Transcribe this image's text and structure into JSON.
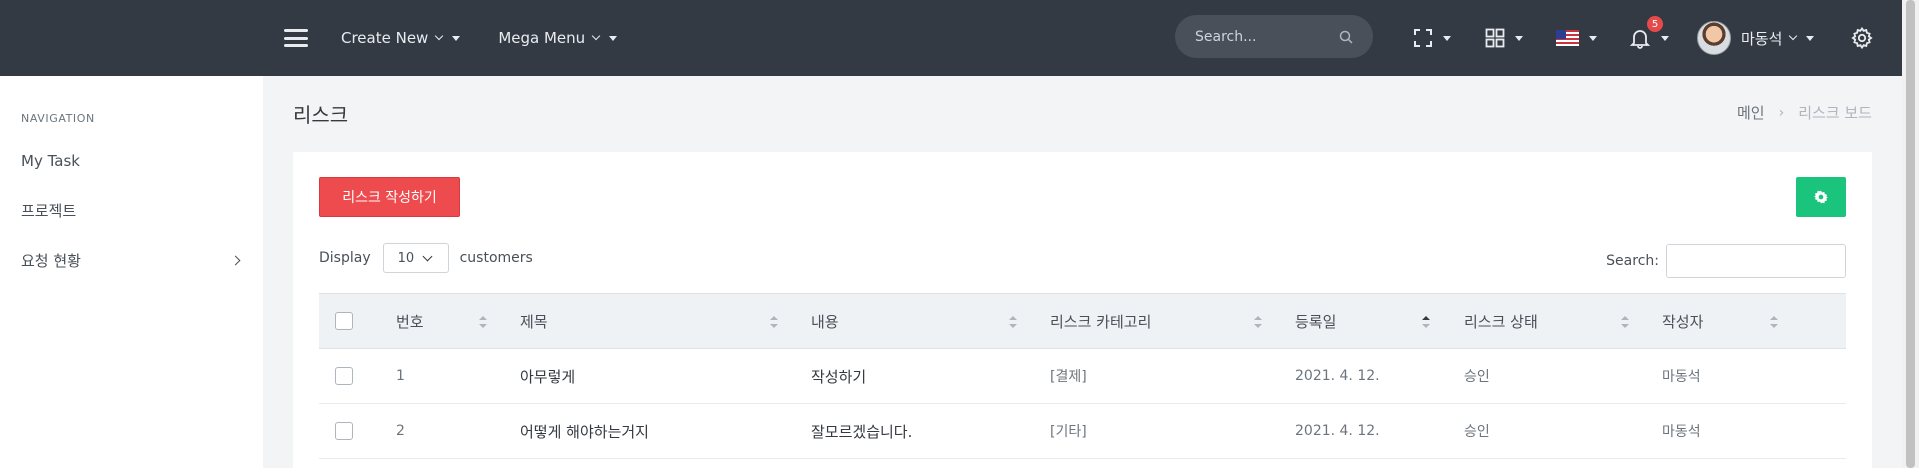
{
  "topbar": {
    "menu_icon": "hamburger-menu-icon",
    "create_new": "Create New",
    "mega_menu": "Mega Menu",
    "search_placeholder": "Search...",
    "notification_count": "5",
    "user_name": "마동석",
    "icons": [
      "fullscreen-icon",
      "apps-grid-icon",
      "us-flag-icon",
      "bell-icon",
      "settings-gear-icon"
    ]
  },
  "sidebar": {
    "section_title": "NAVIGATION",
    "items": [
      {
        "label": "My Task"
      },
      {
        "label": "프로젝트"
      },
      {
        "label": "요청 현황"
      }
    ]
  },
  "page": {
    "title": "리스크",
    "breadcrumb": {
      "home": "메인",
      "separator": "›",
      "current": "리스크 보드"
    }
  },
  "card": {
    "create_button": "리스크 작성하기",
    "display_label": "Display",
    "page_size": "10",
    "customers_label": "customers",
    "search_label": "Search:"
  },
  "table": {
    "columns": [
      "번호",
      "제목",
      "내용",
      "리스크 카테고리",
      "등록일",
      "리스크 상태",
      "작성자"
    ],
    "sorted_column": "등록일",
    "rows": [
      {
        "no": "1",
        "title": "아무렇게",
        "content": "작성하기",
        "category": "[결제]",
        "date": "2021. 4. 12.",
        "status": "승인",
        "author": "마동석"
      },
      {
        "no": "2",
        "title": "어떻게 해야하는거지",
        "content": "잘모르겠습니다.",
        "category": "[기타]",
        "date": "2021. 4. 12.",
        "status": "승인",
        "author": "마동석"
      }
    ]
  },
  "colors": {
    "topbar_bg": "#343a43",
    "danger": "#ee4b4e",
    "success": "#1bc47d",
    "badge": "#e74a4a"
  }
}
